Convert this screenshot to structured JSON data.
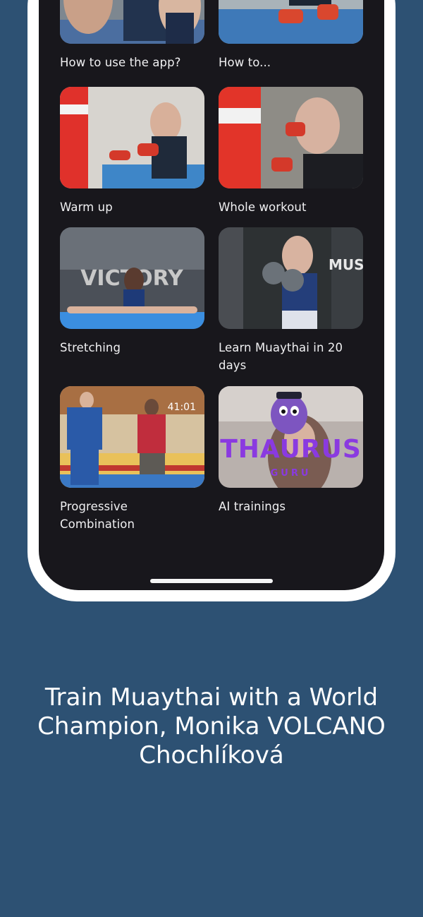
{
  "cards": [
    {
      "label": "How to use the app?",
      "image": "boxing-sparring-photo"
    },
    {
      "label": "How to...",
      "image": "fighter-wrapped-hands-photo"
    },
    {
      "label": "Warm up",
      "image": "heavy-bag-warmup-photo"
    },
    {
      "label": "Whole workout",
      "image": "fighter-guard-stance-photo"
    },
    {
      "label": "Stretching",
      "image": "splits-stretch-photo"
    },
    {
      "label": "Learn Muaythai in 20 days",
      "image": "fighter-boxing-gloves-photo"
    },
    {
      "label": "Progressive Combination",
      "image": "pads-training-photo",
      "badge": "41:01"
    },
    {
      "label": "AI trainings",
      "image": "thaurus-guru-logo-photo",
      "overlay_text": "THAURUS",
      "overlay_sub": "GURU"
    }
  ],
  "caption": "Train Muaythai with a World Champion, Monika VOLCANO Chochlíková",
  "colors": {
    "background": "#2d5173",
    "screen": "#18171c",
    "frame": "#ffffff"
  }
}
